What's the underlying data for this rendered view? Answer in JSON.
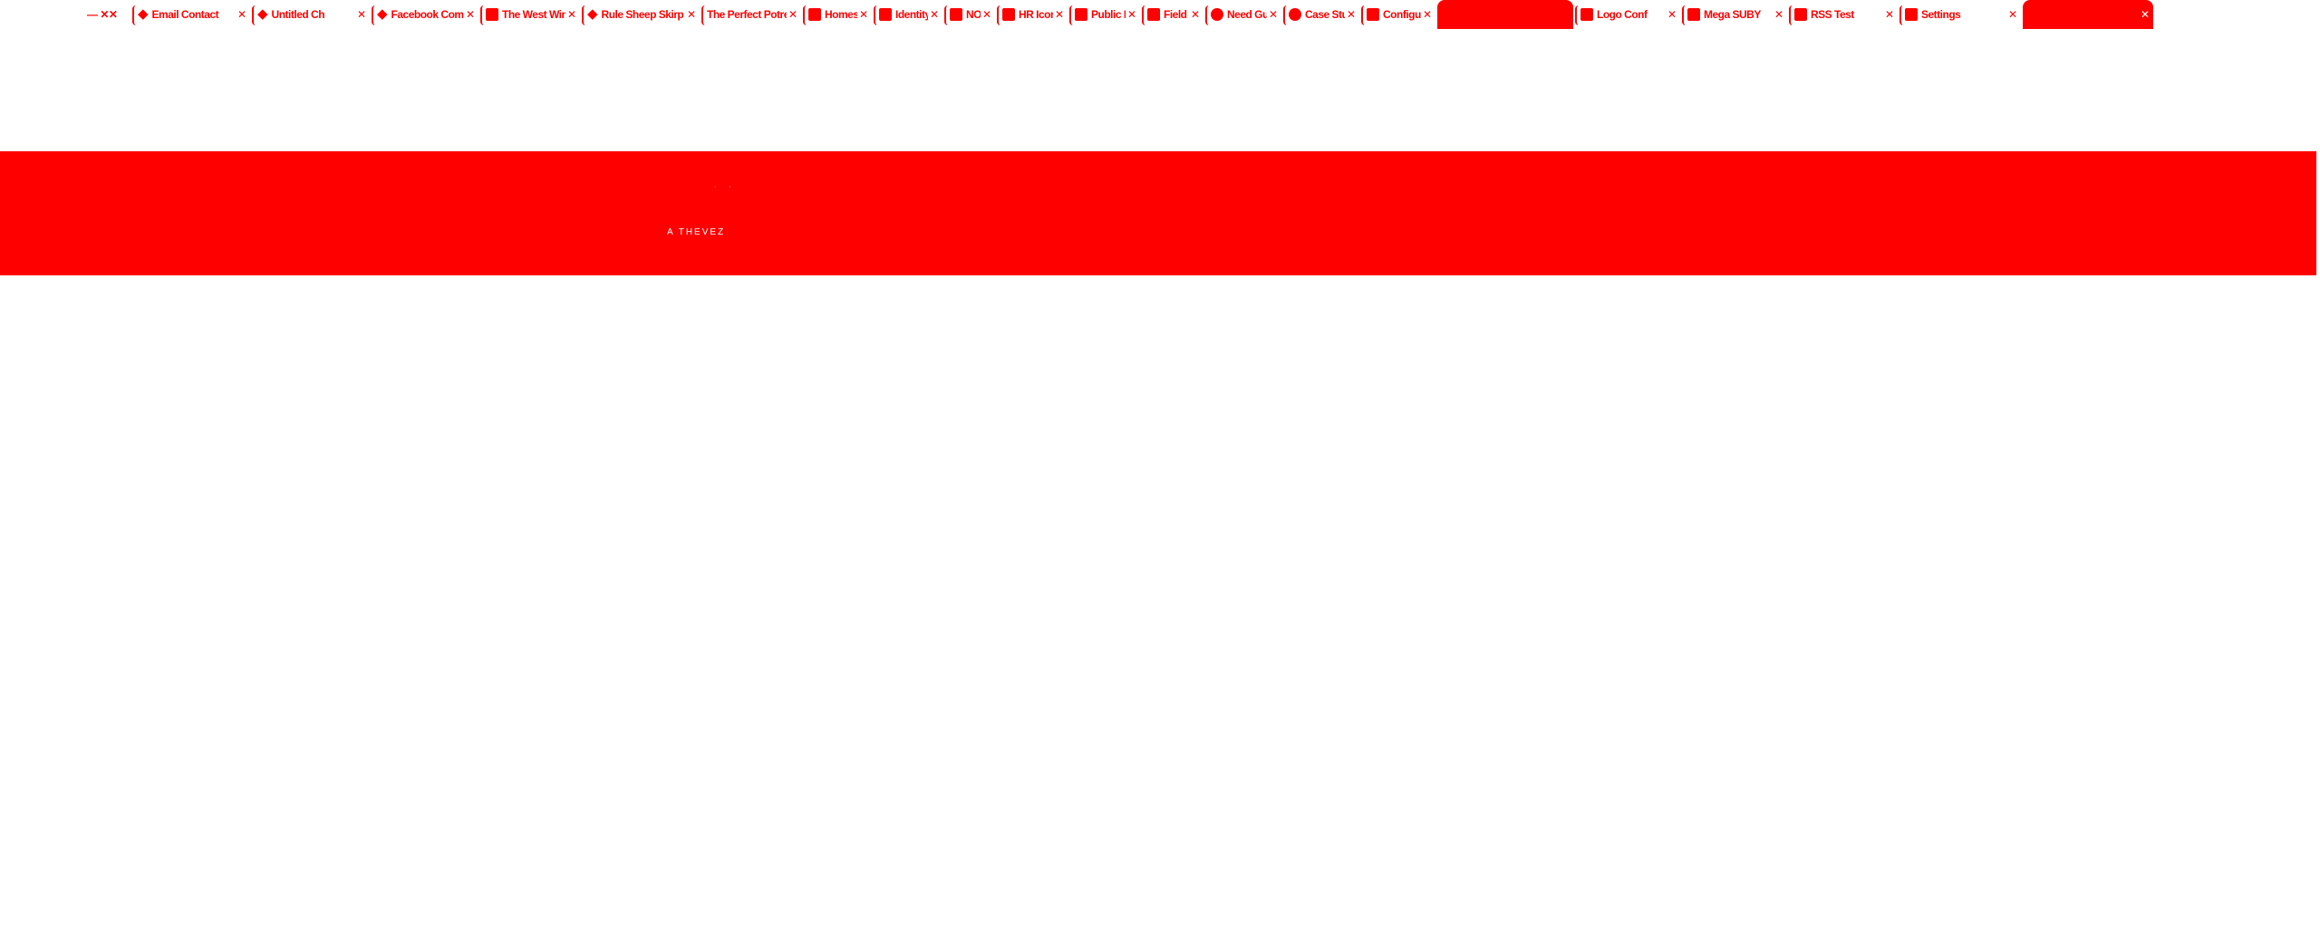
{
  "window": {
    "controls_label": "— ✕✕"
  },
  "tabs": [
    {
      "title": "Email Contact",
      "icon": "shield-icon"
    },
    {
      "title": "Untitled Ch",
      "icon": "shield-icon"
    },
    {
      "title": "Facebook Com",
      "icon": "shield-icon"
    },
    {
      "title": "The West Wing",
      "icon": "square-icon"
    },
    {
      "title": "Rule Sheep Skirp O",
      "icon": "shield-icon"
    },
    {
      "title": "The Perfect Potred",
      "icon": "none"
    },
    {
      "title": "Homes Sale",
      "icon": "square-icon"
    },
    {
      "title": "Identity Search",
      "icon": "square-icon"
    },
    {
      "title": "NOW",
      "icon": "square-icon"
    },
    {
      "title": "HR Icon Public",
      "icon": "square-icon"
    },
    {
      "title": "Public Hold",
      "icon": "square-icon"
    },
    {
      "title": "Field help",
      "icon": "square-icon"
    },
    {
      "title": "Need Guide",
      "icon": "globe-icon"
    },
    {
      "title": "Case Study",
      "icon": "globe-icon"
    },
    {
      "title": "Configure the",
      "icon": "square-icon"
    },
    {
      "title": "",
      "icon": "none",
      "highlight": true
    },
    {
      "title": "Logo Conf",
      "icon": "square-icon"
    },
    {
      "title": "Mega SUBY",
      "icon": "square-icon"
    },
    {
      "title": "RSS Test",
      "icon": "square-icon"
    },
    {
      "title": "Settings",
      "icon": "square-icon"
    },
    {
      "title": "",
      "icon": "none",
      "active": true
    }
  ],
  "banner": {
    "line1": "· ·",
    "line2": "A THEVEZ"
  },
  "colors": {
    "accent": "#ff0000",
    "background": "#ffffff"
  }
}
